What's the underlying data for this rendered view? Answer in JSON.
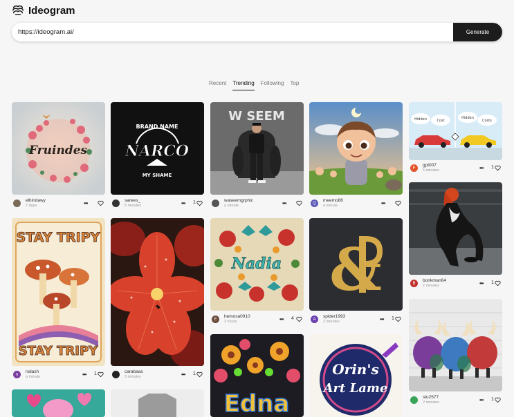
{
  "app": {
    "name": "Ideogram"
  },
  "prompt": {
    "value": "https://ideogram.ai/",
    "generate_label": "Generate"
  },
  "tabs": [
    {
      "label": "Recent"
    },
    {
      "label": "Trending"
    },
    {
      "label": "Following"
    },
    {
      "label": "Top"
    }
  ],
  "cards": [
    {
      "user": "elhindawy",
      "time": "7 days",
      "likes": "",
      "avatar_letter": "",
      "avatar_color": "#7a6a58"
    },
    {
      "user": "sarees_",
      "time": "6 minutes",
      "likes": "1",
      "avatar_letter": "",
      "avatar_color": "#333333"
    },
    {
      "user": "waseemgrphic",
      "time": "a minute",
      "likes": "",
      "avatar_letter": "",
      "avatar_color": "#555555"
    },
    {
      "user": "meemo86",
      "time": "a minute",
      "likes": "",
      "avatar_letter": "Q",
      "avatar_color": "#5b58b8"
    },
    {
      "user": "gpt007",
      "time": "5 minutes",
      "likes": "1",
      "avatar_letter": "F",
      "avatar_color": "#e4542c"
    },
    {
      "user": "nalash",
      "time": "a minute",
      "likes": "1",
      "avatar_letter": "n",
      "avatar_color": "#7b3fa0"
    },
    {
      "user": "carabaas",
      "time": "3 minutes",
      "likes": "1",
      "avatar_letter": "",
      "avatar_color": "#222222"
    },
    {
      "user": "hemosa0910",
      "time": "3 hours",
      "likes": "4",
      "avatar_letter": "E",
      "avatar_color": "#6b4a3a"
    },
    {
      "user": "spider1993",
      "time": "2 minutes",
      "likes": "1",
      "avatar_letter": "A",
      "avatar_color": "#6a3fb0"
    },
    {
      "user": "bonkman64",
      "time": "2 minutes",
      "likes": "1",
      "avatar_letter": "B",
      "avatar_color": "#c0322d"
    },
    {
      "user": "stu2577",
      "time": "2 minutes",
      "likes": "1",
      "avatar_letter": "",
      "avatar_color": "#3aa55a"
    }
  ],
  "image_text": {
    "fruindes": "Fruindes",
    "brand_name": "BRAND NAME",
    "narco": "NARCO",
    "my_shame": "MY SHAME",
    "waseem": "W SEEM",
    "hidden": "Hidden",
    "cost": "Cost",
    "costs": "Costs",
    "stay_tripy_top": "STAY TRIPY",
    "stay_tripy_bottom": "STAY TRIPY",
    "nadia": "Nadia",
    "orins": "Orin's",
    "art_lame": "Art Lame",
    "edna": "Edna"
  },
  "colors": {
    "accent": "#1c1c1c",
    "background": "#f6f6f7"
  }
}
